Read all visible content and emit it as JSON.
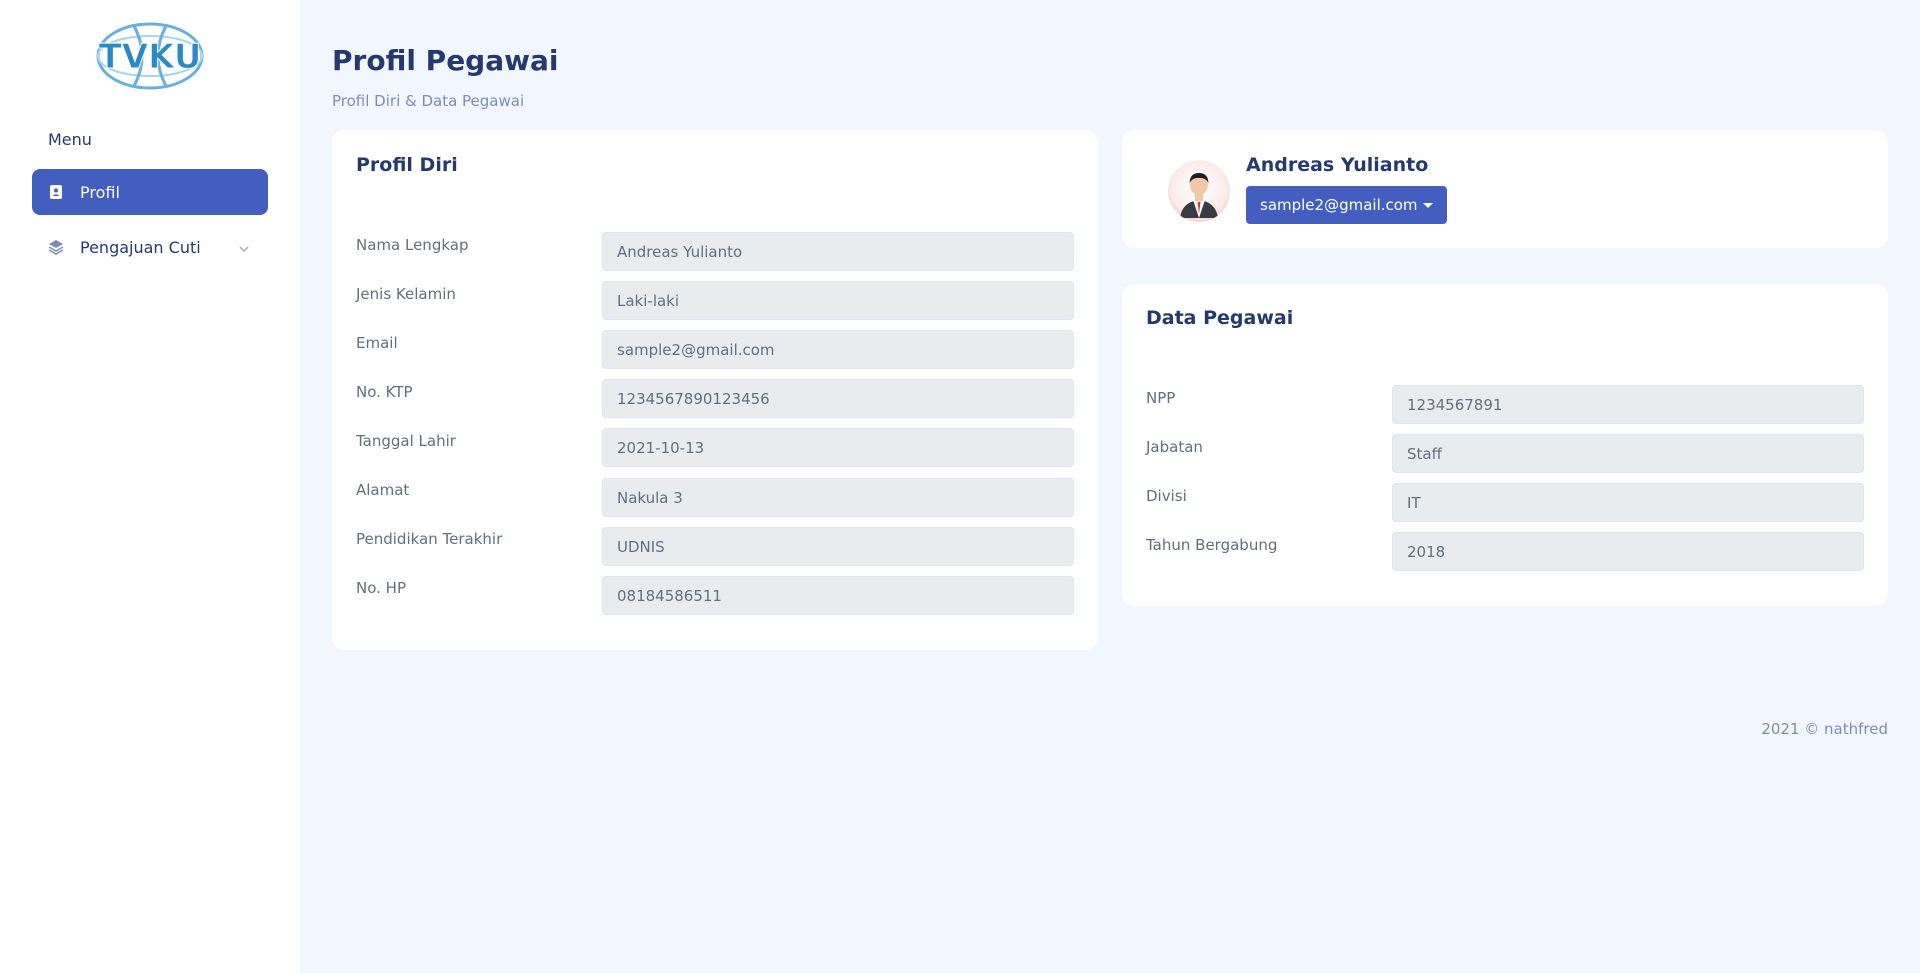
{
  "sidebar": {
    "logo_text": "TVKU",
    "menu_title": "Menu",
    "items": [
      {
        "label": "Profil",
        "icon": "contact-book-icon"
      },
      {
        "label": "Pengajuan Cuti",
        "icon": "layers-icon"
      }
    ]
  },
  "page": {
    "title": "Profil Pegawai",
    "subtitle": "Profil Diri & Data Pegawai"
  },
  "profil_diri": {
    "title": "Profil Diri",
    "fields": [
      {
        "label": "Nama Lengkap",
        "value": "Andreas Yulianto"
      },
      {
        "label": "Jenis Kelamin",
        "value": "Laki-laki"
      },
      {
        "label": "Email",
        "value": "sample2@gmail.com"
      },
      {
        "label": "No. KTP",
        "value": "1234567890123456"
      },
      {
        "label": "Tanggal Lahir",
        "value": "2021-10-13"
      },
      {
        "label": "Alamat",
        "value": "Nakula 3"
      },
      {
        "label": "Pendidikan Terakhir",
        "value": "UDNIS"
      },
      {
        "label": "No. HP",
        "value": "08184586511"
      }
    ]
  },
  "user": {
    "name": "Andreas Yulianto",
    "email": "sample2@gmail.com"
  },
  "data_pegawai": {
    "title": "Data Pegawai",
    "fields": [
      {
        "label": "NPP",
        "value": "1234567891"
      },
      {
        "label": "Jabatan",
        "value": "Staff"
      },
      {
        "label": "Divisi",
        "value": "IT"
      },
      {
        "label": "Tahun Bergabung",
        "value": "2018"
      }
    ]
  },
  "footer": {
    "text": "2021 © nathfred"
  },
  "colors": {
    "primary": "#435ebe",
    "background": "#f2f7ff",
    "heading": "#25396f",
    "input_bg": "#e9ecef"
  }
}
